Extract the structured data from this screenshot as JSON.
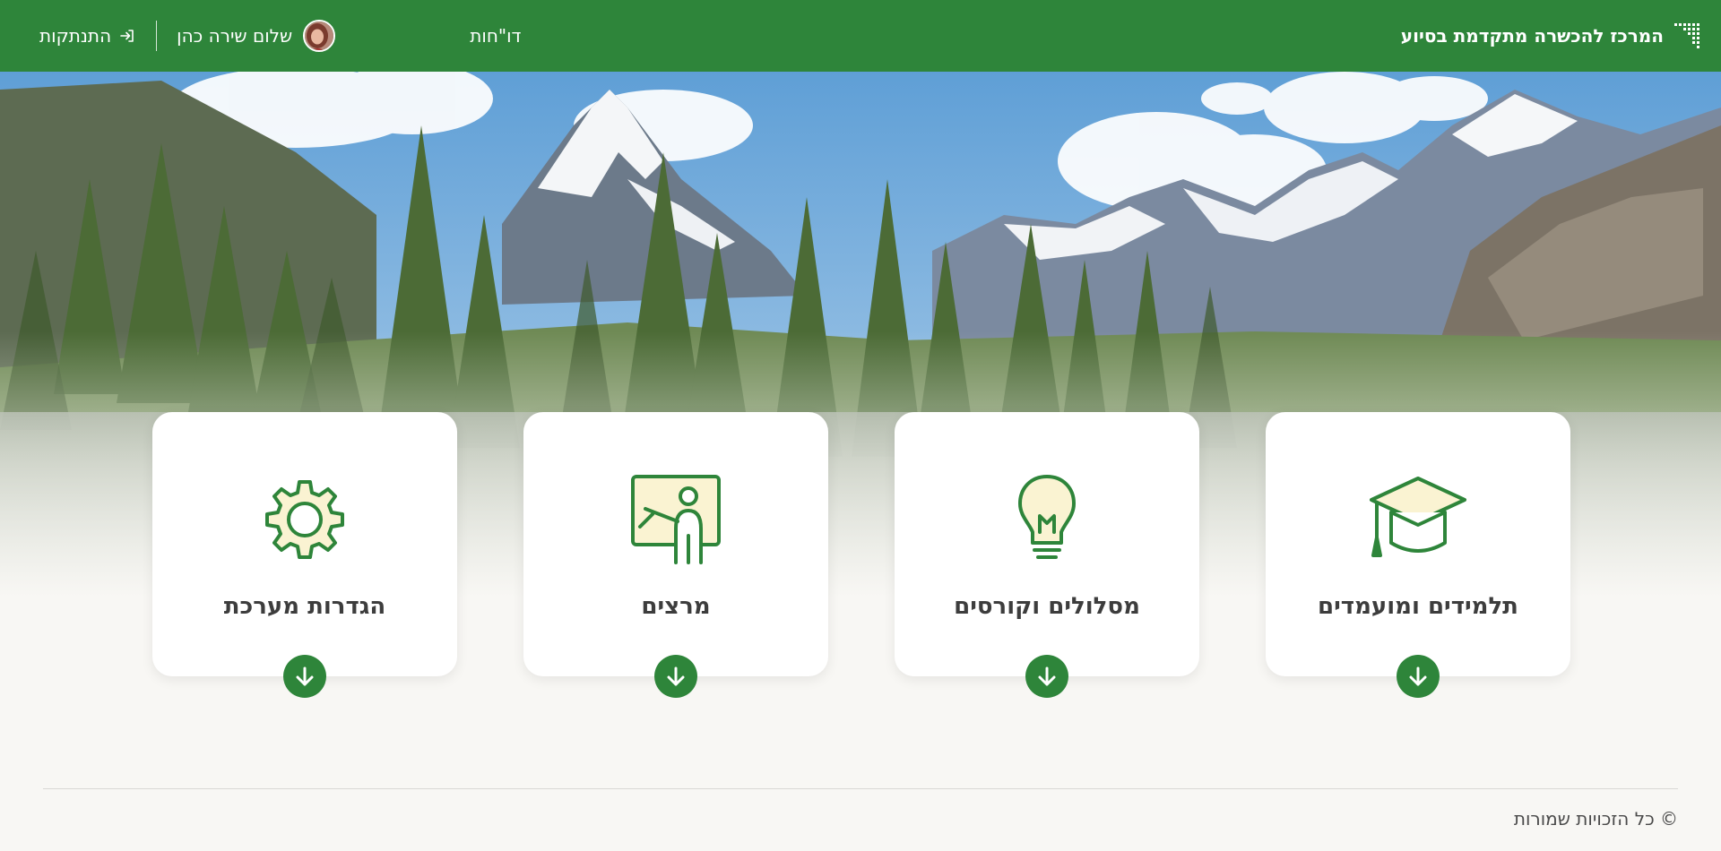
{
  "header": {
    "brand_title": "המרכז להכשרה מתקדמת בסיוע",
    "reports_label": "דו\"חות",
    "greeting": "שלום שירה כהן",
    "logout_label": "התנתקות"
  },
  "cards": [
    {
      "title": "תלמידים ומועמדים",
      "icon": "graduation-cap-icon"
    },
    {
      "title": "מסלולים וקורסים",
      "icon": "lightbulb-icon"
    },
    {
      "title": "מרצים",
      "icon": "teacher-board-icon"
    },
    {
      "title": "הגדרות מערכת",
      "icon": "gear-icon"
    }
  ],
  "footer": {
    "copyright": "© כל הזכויות שמורות"
  },
  "colors": {
    "primary_green": "#2e853a",
    "icon_fill": "#faf3d2",
    "page_bg": "#f8f7f4"
  }
}
